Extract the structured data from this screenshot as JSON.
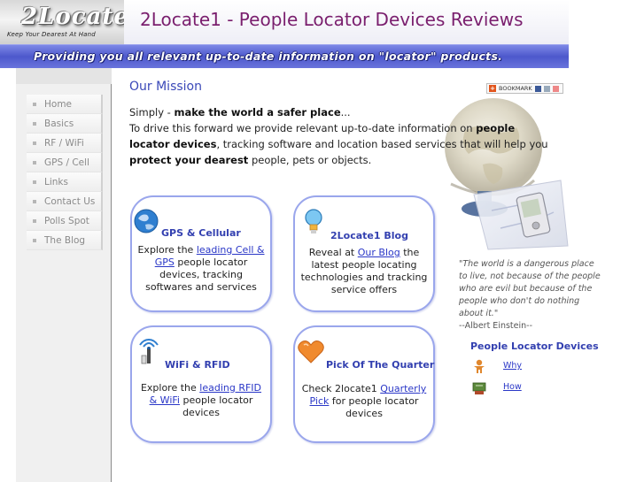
{
  "header": {
    "logo_text": "2Locate1",
    "logo_tagline": "Keep Your Dearest At Hand",
    "title": "2Locate1 - People Locator Devices Reviews",
    "banner": "Providing you all relevant up-to-date information on \"locator\" products."
  },
  "sidebar": {
    "items": [
      {
        "label": "Home"
      },
      {
        "label": "Basics"
      },
      {
        "label": "RF / WiFi"
      },
      {
        "label": "GPS / Cell"
      },
      {
        "label": "Links"
      },
      {
        "label": "Contact Us"
      },
      {
        "label": "Polls Spot"
      },
      {
        "label": "The Blog"
      }
    ]
  },
  "main": {
    "mission_title": "Our Mission",
    "bookmark_label": "BOOKMARK",
    "intro": {
      "p1_prefix": "Simply - ",
      "p1_bold": "make the world a safer place",
      "p1_suffix": "...",
      "p2_a": "To drive this forward we provide relevant up-to-date information on ",
      "p2_bold1": "people locator devices",
      "p2_b": ", tracking software and location based services that will help you ",
      "p2_bold2": "protect your dearest",
      "p2_c": " people, pets or objects."
    }
  },
  "cards": {
    "gps": {
      "title": "GPS & Cellular",
      "text_a": "Explore the ",
      "link": "leading Cell & GPS",
      "text_b": " people locator devices, tracking softwares and services"
    },
    "blog": {
      "title": "2Locate1 Blog",
      "text_a": "Reveal at ",
      "link": "Our Blog",
      "text_b": " the latest people locating technologies and tracking service offers"
    },
    "wifi": {
      "title": "WiFi & RFID",
      "text_a": "Explore the ",
      "link": "leading RFID & WiFi",
      "text_b": " people locator devices"
    },
    "pick": {
      "title": "Pick Of The Quarter",
      "text_a": "Check 2locate1 ",
      "link": "Quarterly Pick",
      "text_b": " for people locator devices"
    }
  },
  "right": {
    "quote": "\"The world is a dangerous place to live, not because of the people who are evil but because of the people who don't do nothing about it.\"",
    "quote_author": "--Albert Einstein--",
    "pld_title": "People Locator Devices",
    "pld_links": [
      {
        "label": "Why"
      },
      {
        "label": "How"
      }
    ]
  },
  "colors": {
    "accent_blue": "#3340b0",
    "title_purple": "#7a1f6e",
    "card_border": "#9aa6ec",
    "link": "#2a37c7"
  }
}
